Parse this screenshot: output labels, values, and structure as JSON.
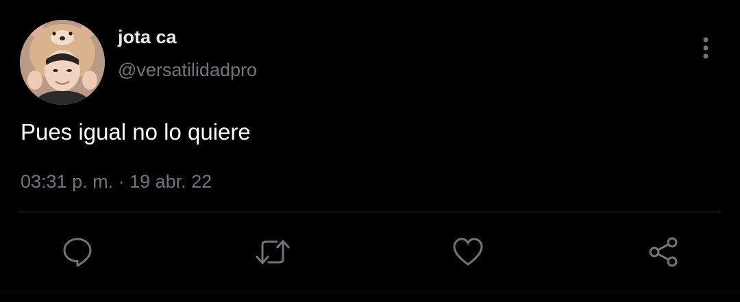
{
  "tweet": {
    "author": {
      "display_name": "jota ca",
      "handle": "@versatilidadpro",
      "avatar_icon": "user-avatar"
    },
    "text": "Pues igual no lo quiere",
    "timestamp": {
      "time": "03:31 p. m.",
      "separator": " · ",
      "date": "19 abr. 22"
    },
    "more_icon": "more-vertical-icon",
    "actions": [
      {
        "name": "reply",
        "icon": "reply-icon"
      },
      {
        "name": "retweet",
        "icon": "retweet-icon"
      },
      {
        "name": "like",
        "icon": "heart-icon"
      },
      {
        "name": "share",
        "icon": "share-icon"
      }
    ]
  },
  "colors": {
    "background": "#000000",
    "primary_text": "#ffffff",
    "secondary_text": "#6e767d",
    "divider": "#2f3336"
  }
}
